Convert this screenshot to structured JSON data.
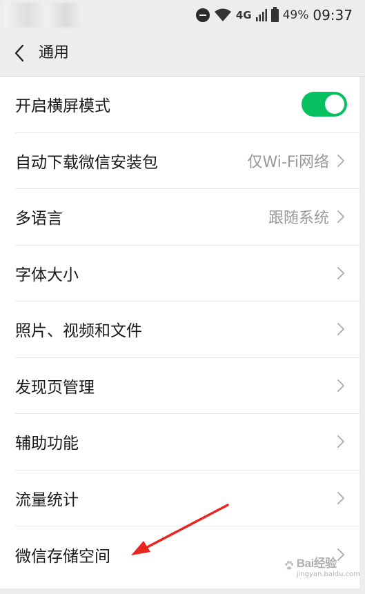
{
  "status_bar": {
    "network": "4G",
    "battery_percent": "49%",
    "time": "09:37",
    "icons": [
      "do-not-disturb-icon",
      "wifi-icon",
      "signal-icon",
      "battery-charging-icon"
    ]
  },
  "nav": {
    "back_icon": "chevron-left-icon",
    "title": "通用"
  },
  "settings": {
    "items": [
      {
        "label": "开启横屏模式",
        "value": "",
        "control": "toggle",
        "toggle_on": true
      },
      {
        "label": "自动下载微信安装包",
        "value": "仅Wi-Fi网络",
        "control": "chevron"
      },
      {
        "label": "多语言",
        "value": "跟随系统",
        "control": "chevron"
      },
      {
        "label": "字体大小",
        "value": "",
        "control": "chevron"
      },
      {
        "label": "照片、视频和文件",
        "value": "",
        "control": "chevron"
      },
      {
        "label": "发现页管理",
        "value": "",
        "control": "chevron"
      },
      {
        "label": "辅助功能",
        "value": "",
        "control": "chevron"
      },
      {
        "label": "流量统计",
        "value": "",
        "control": "chevron"
      },
      {
        "label": "微信存储空间",
        "value": "",
        "control": "chevron"
      }
    ]
  },
  "annotation": {
    "type": "red-arrow",
    "color": "#e8251f"
  },
  "watermark": {
    "text": "Bai",
    "text2": "经验",
    "sub": "jingyan.baidu.com"
  },
  "colors": {
    "accent": "#07c160",
    "background": "#ededed",
    "row_bg": "#ffffff",
    "secondary_text": "#999999"
  }
}
